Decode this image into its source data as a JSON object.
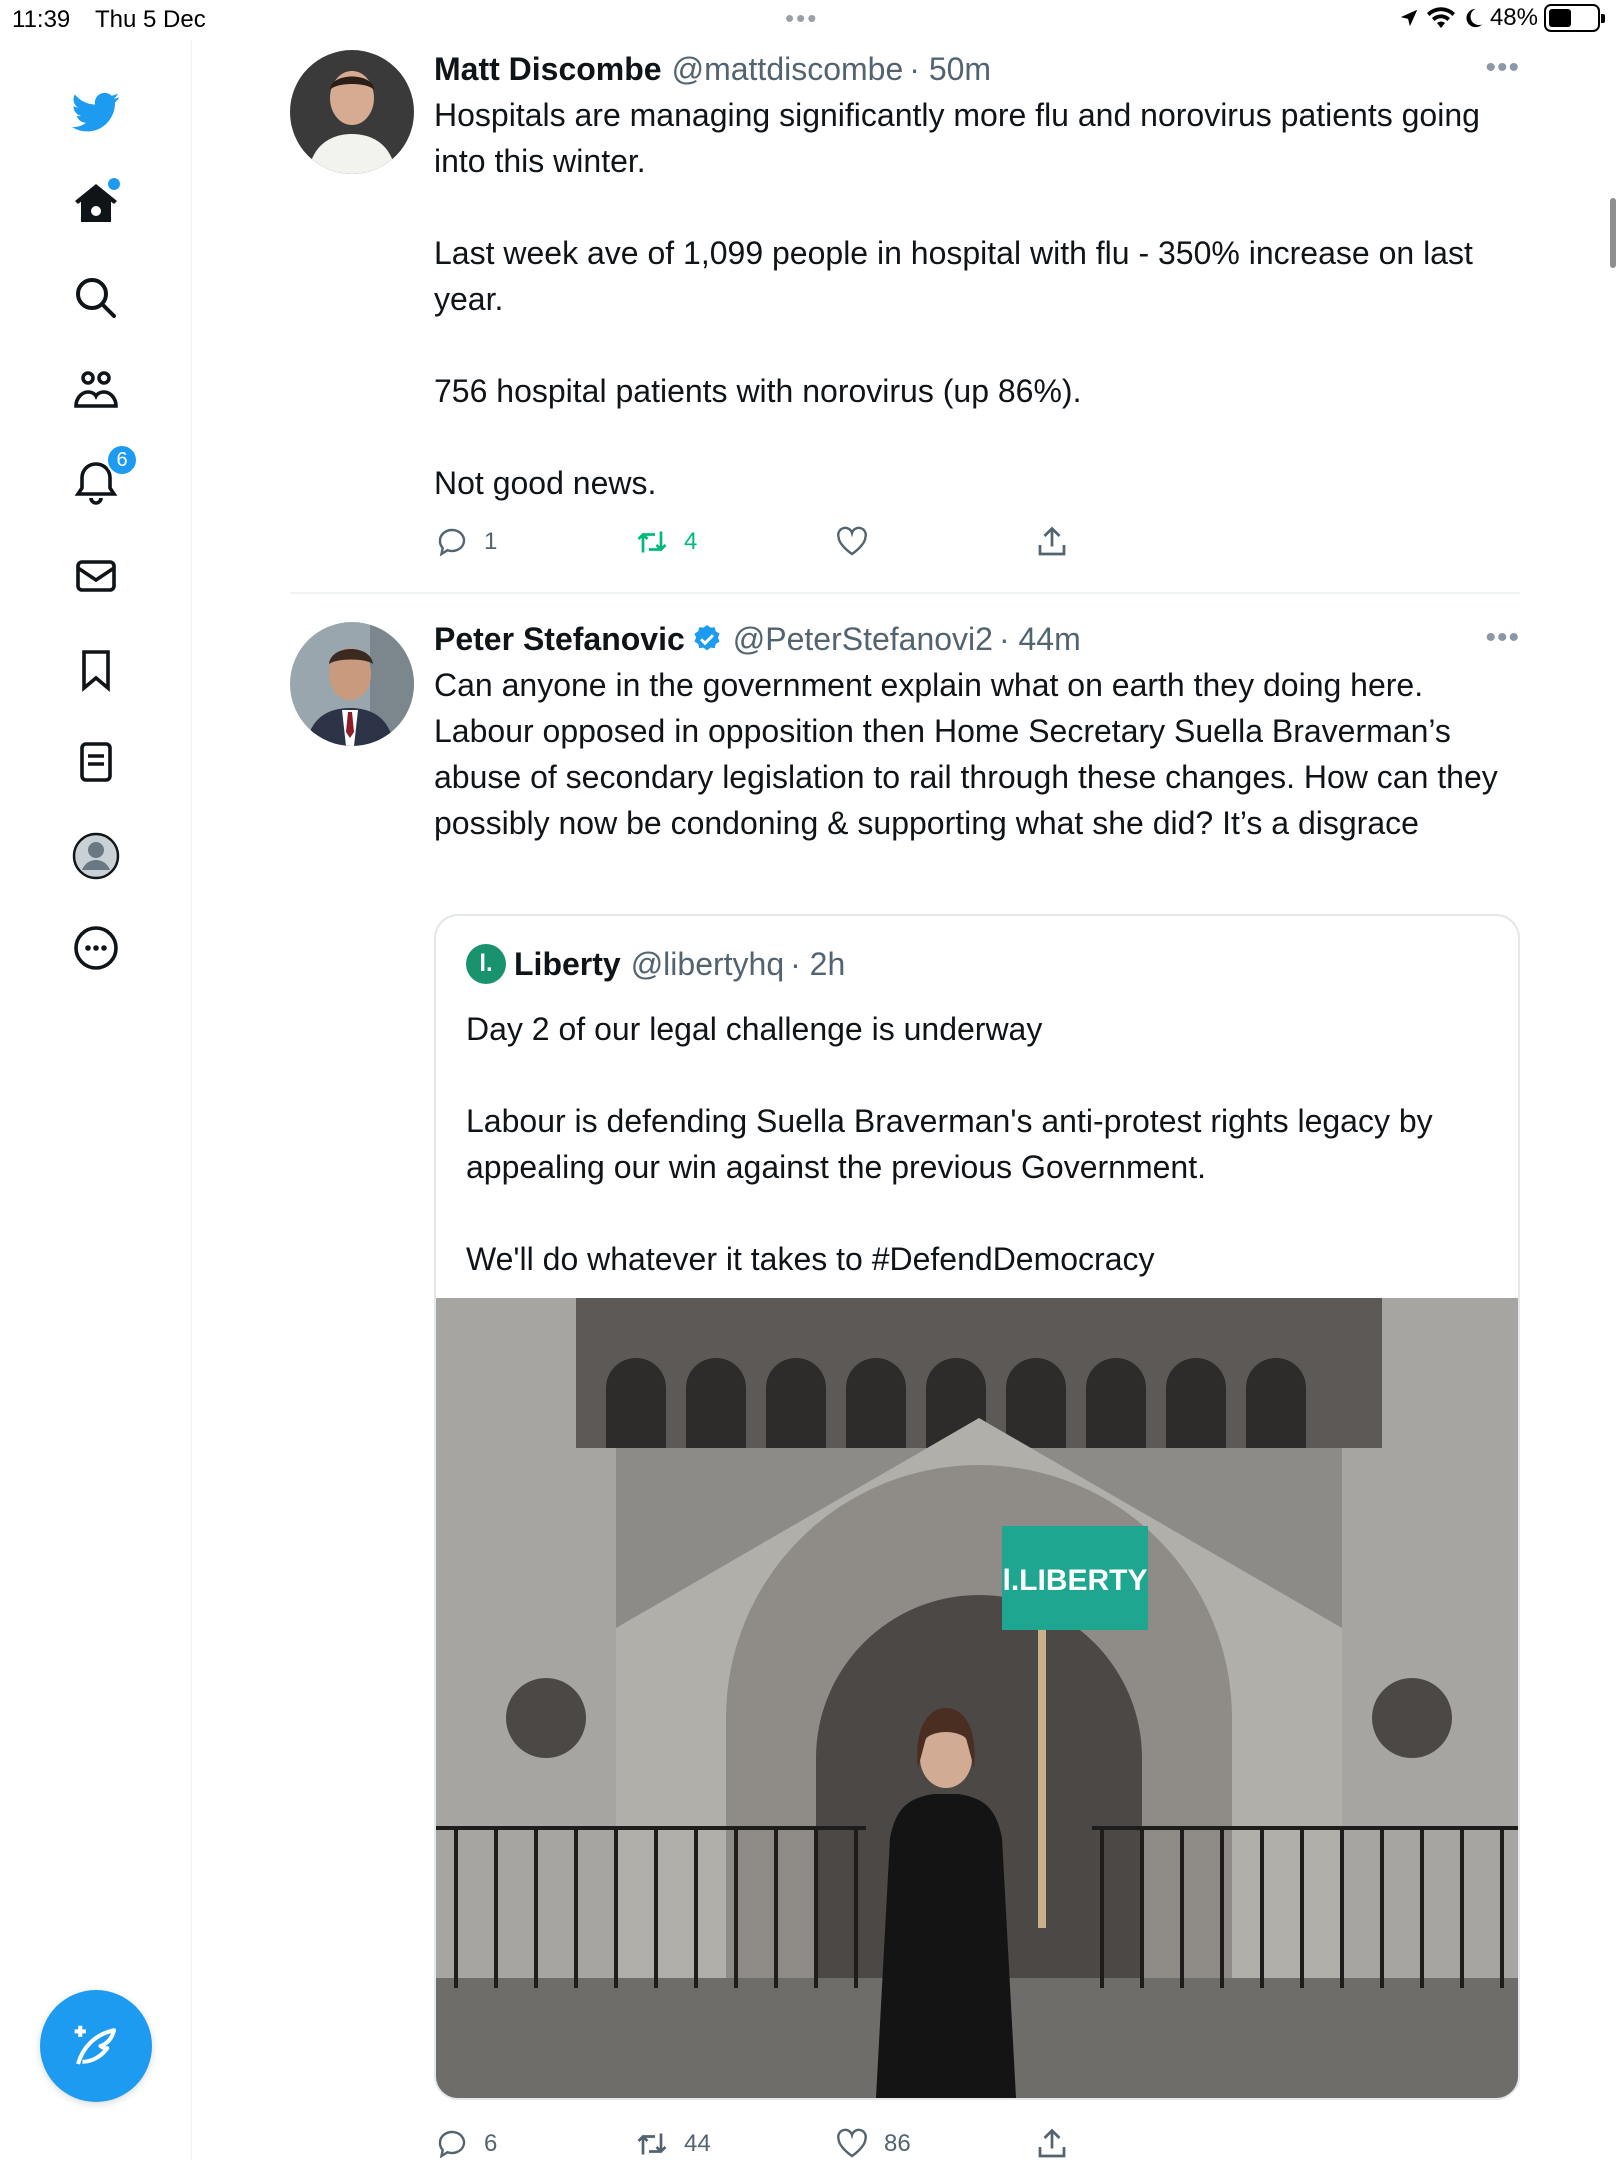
{
  "status_bar": {
    "time": "11:39",
    "date": "Thu 5 Dec",
    "battery": "48%",
    "battery_level": 0.48
  },
  "sidebar": {
    "items": [
      {
        "icon": "twitter-bird-icon"
      },
      {
        "icon": "home-icon",
        "has_new_dot": true
      },
      {
        "icon": "search-icon"
      },
      {
        "icon": "communities-icon"
      },
      {
        "icon": "notifications-icon",
        "badge": "6"
      },
      {
        "icon": "messages-icon"
      },
      {
        "icon": "bookmarks-icon"
      },
      {
        "icon": "lists-icon"
      },
      {
        "icon": "profile-icon"
      },
      {
        "icon": "more-icon"
      }
    ],
    "compose_icon": "compose-icon",
    "accent": "#1d9bf0"
  },
  "tweets": [
    {
      "name": "Matt Discombe",
      "handle": "@mattdiscombe",
      "time": "· 50m",
      "text": "Hospitals are managing significantly more flu and norovirus patients going into this winter.\n\nLast week ave of 1,099 people in hospital with flu - 350% increase on last year.\n\n756 hospital patients with norovirus (up 86%).\n\nNot good news.",
      "replies": "1",
      "retweets": "4",
      "likes": "",
      "retweeted_color": "#00ba7c"
    },
    {
      "name": "Peter Stefanovic",
      "verified": true,
      "handle": "@PeterStefanovi2",
      "time": "· 44m",
      "text": "Can anyone in the government explain what on earth they doing here. Labour opposed in opposition then Home Secretary Suella Braverman’s abuse of secondary legislation to rail through these changes. How can they possibly now be condoning & supporting what she did? It’s a disgrace",
      "quote": {
        "logo": "l.",
        "name": "Liberty",
        "handle": "@libertyhq",
        "time": "· 2h",
        "text": "Day 2 of our legal challenge is underway\n\nLabour is defending Suella Braverman's anti-protest rights legacy by appealing our win against the previous Government.\n\nWe'll do whatever it takes to #DefendDemocracy",
        "image_sign": "l.LIBERTY",
        "brand_color": "#19936e"
      },
      "replies": "6",
      "retweets": "44",
      "likes": "86"
    }
  ]
}
